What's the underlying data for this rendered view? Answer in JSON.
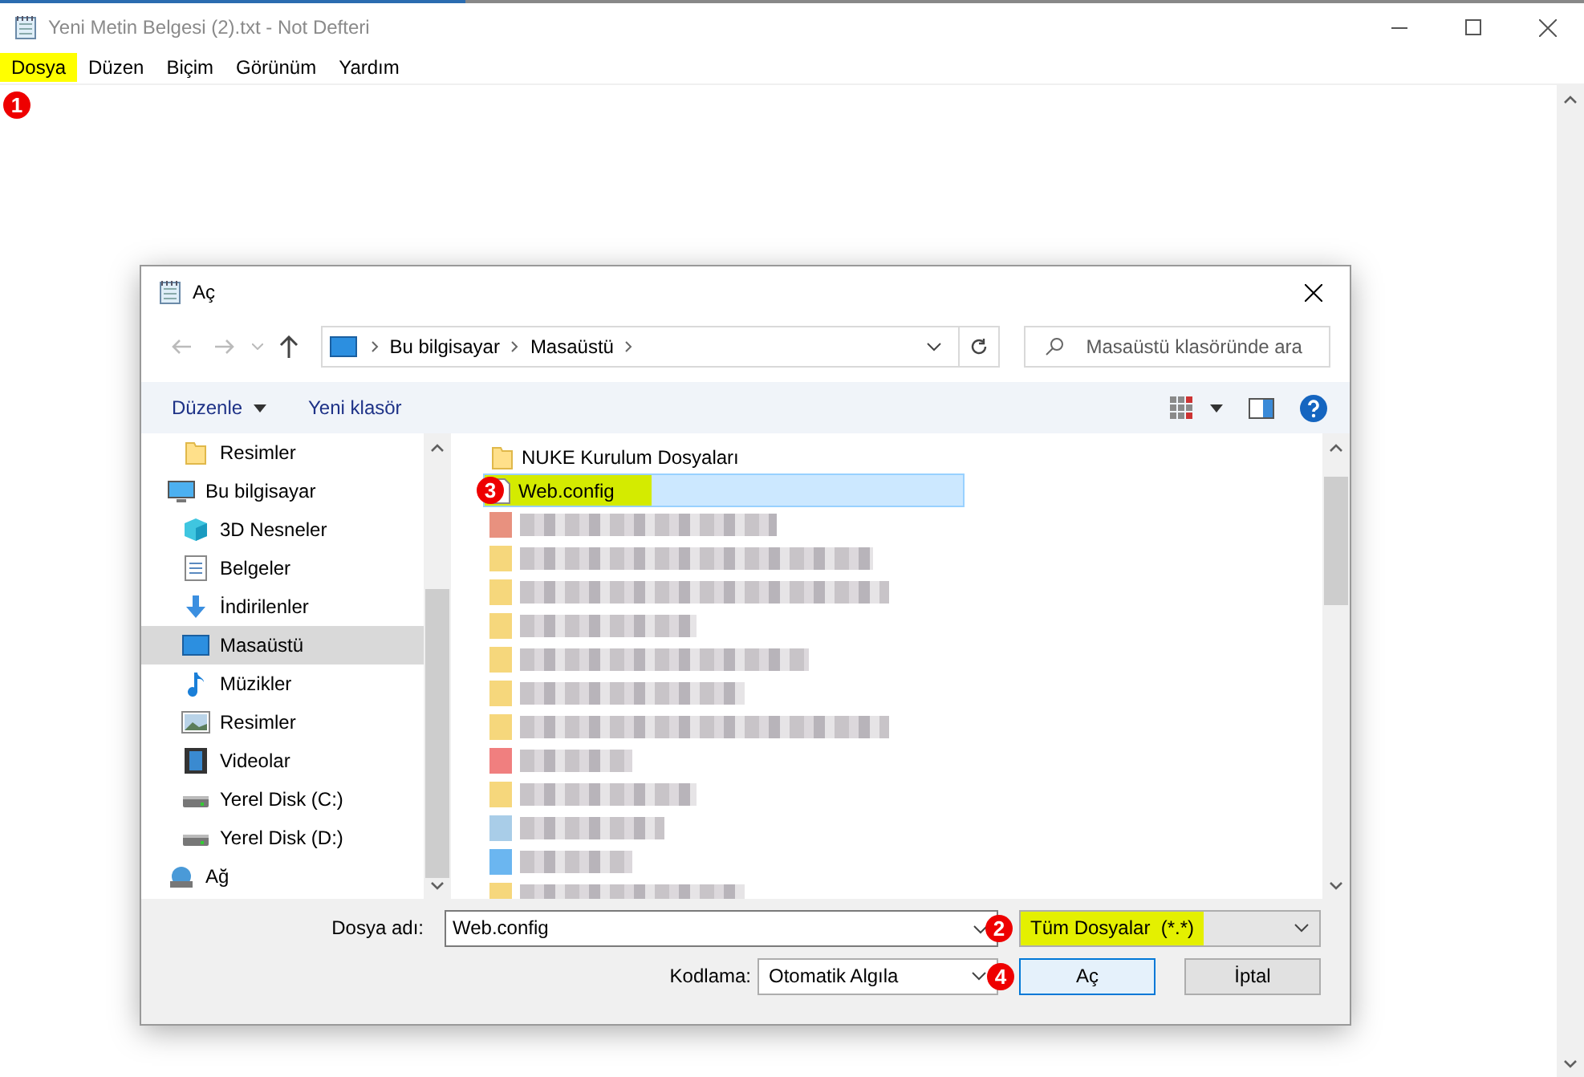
{
  "window": {
    "title": "Yeni Metin Belgesi (2).txt - Not Defteri"
  },
  "menu": [
    {
      "label": "Dosya",
      "highlighted": true,
      "marker": "1"
    },
    {
      "label": "Düzen",
      "highlighted": false
    },
    {
      "label": "Biçim",
      "highlighted": false
    },
    {
      "label": "Görünüm",
      "highlighted": false
    },
    {
      "label": "Yardım",
      "highlighted": false
    }
  ],
  "dialog": {
    "title": "Aç",
    "breadcrumb": [
      "Bu bilgisayar",
      "Masaüstü"
    ],
    "search": {
      "placeholder": "Masaüstü klasöründe ara"
    },
    "toolbar": [
      {
        "label": "Düzenle",
        "kind": "menu"
      },
      {
        "label": "Yeni klasör",
        "kind": "plain"
      }
    ],
    "sidebar": [
      {
        "label": "Resimler",
        "kind": "folder",
        "selected": false
      },
      {
        "label": "Bu bilgisayar",
        "kind": "computer",
        "selected": false,
        "children": [
          {
            "label": "3D Nesneler",
            "kind": "cube",
            "selected": false
          },
          {
            "label": "Belgeler",
            "kind": "document",
            "selected": false
          },
          {
            "label": "İndirilenler",
            "kind": "download",
            "selected": false
          },
          {
            "label": "Masaüstü",
            "kind": "desktop",
            "selected": true
          },
          {
            "label": "Müzikler",
            "kind": "music",
            "selected": false
          },
          {
            "label": "Resimler",
            "kind": "image",
            "selected": false
          },
          {
            "label": "Videolar",
            "kind": "video",
            "selected": false
          },
          {
            "label": "Yerel Disk (C:)",
            "kind": "drive",
            "selected": false
          },
          {
            "label": "Yerel Disk (D:)",
            "kind": "drive",
            "selected": false
          }
        ]
      },
      {
        "label": "Ağ",
        "kind": "network",
        "selected": false
      }
    ],
    "files": [
      {
        "name": "NUKE Kurulum Dosyaları",
        "kind": "folder",
        "selected": false,
        "highlighted": false
      },
      {
        "name": "Web.config",
        "kind": "file",
        "selected": true,
        "highlighted": true,
        "marker": "3"
      },
      {
        "kind": "blurred",
        "color": "#e8917f"
      },
      {
        "kind": "blurred",
        "color": "#f6d77c"
      },
      {
        "kind": "blurred",
        "color": "#f6d77c"
      },
      {
        "kind": "blurred",
        "color": "#f6d77c"
      },
      {
        "kind": "blurred",
        "color": "#f6d77c"
      },
      {
        "kind": "blurred",
        "color": "#f6d77c"
      },
      {
        "kind": "blurred",
        "color": "#f6d77c"
      },
      {
        "kind": "blurred",
        "color": "#f07f7f"
      },
      {
        "kind": "blurred",
        "color": "#f6d77c"
      },
      {
        "kind": "blurred",
        "color": "#a9cde8"
      },
      {
        "kind": "blurred",
        "color": "#6bb6f0"
      },
      {
        "kind": "blurred",
        "color": "#f6d77c"
      }
    ],
    "filename": {
      "label": "Dosya adı:",
      "value": "Web.config"
    },
    "filter": {
      "value": "Tüm Dosyalar  (*.*)",
      "highlighted": true,
      "marker": "2"
    },
    "encoding": {
      "label": "Kodlama:",
      "value": "Otomatik Algıla"
    },
    "buttons": [
      {
        "label": "Aç",
        "kind": "default",
        "marker": "4"
      },
      {
        "label": "İptal",
        "kind": "normal"
      }
    ]
  }
}
